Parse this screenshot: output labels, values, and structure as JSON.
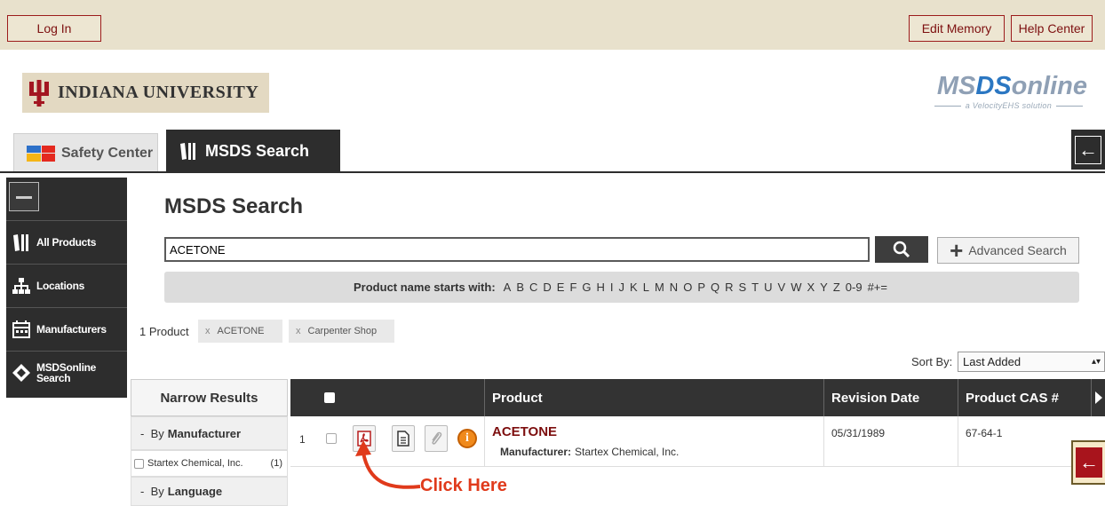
{
  "topbar": {
    "login": "Log In",
    "edit_memory": "Edit Memory",
    "help_center": "Help Center"
  },
  "header": {
    "university": "INDIANA UNIVERSITY",
    "brand": {
      "ms": "MS",
      "ds": "DS",
      "online": "online",
      "tagline": "a VelocityEHS solution"
    }
  },
  "tabs": [
    {
      "label": "Safety Center"
    },
    {
      "label": "MSDS Search"
    }
  ],
  "sidebar": {
    "items": [
      {
        "label": "All Products"
      },
      {
        "label": "Locations"
      },
      {
        "label": "Manufacturers"
      },
      {
        "label": "MSDSonline Search"
      }
    ]
  },
  "main": {
    "title": "MSDS Search",
    "search_value": "ACETONE",
    "advanced_search": "Advanced Search",
    "starts_with_label": "Product name starts with:",
    "letters": [
      "A",
      "B",
      "C",
      "D",
      "E",
      "F",
      "G",
      "H",
      "I",
      "J",
      "K",
      "L",
      "M",
      "N",
      "O",
      "P",
      "Q",
      "R",
      "S",
      "T",
      "U",
      "V",
      "W",
      "X",
      "Y",
      "Z",
      "0-9",
      "#+="
    ],
    "product_count": "1 Product",
    "chips": [
      {
        "x": "x",
        "label": "ACETONE"
      },
      {
        "x": "x",
        "label": "Carpenter Shop"
      }
    ],
    "sort_label": "Sort By:",
    "sort_value": "Last Added"
  },
  "narrow": {
    "title": "Narrow Results",
    "groups": [
      {
        "dash": "-",
        "prefix": "By",
        "name": "Manufacturer"
      },
      {
        "dash": "-",
        "prefix": "By",
        "name": "Language"
      }
    ],
    "manufacturer_option": {
      "label": "Startex Chemical, Inc.",
      "count": "(1)"
    }
  },
  "table": {
    "headers": {
      "product": "Product",
      "revision_date": "Revision Date",
      "cas": "Product CAS #"
    },
    "rows": [
      {
        "num": "1",
        "product": "ACETONE",
        "manufacturer_label": "Manufacturer:",
        "manufacturer": "Startex Chemical, Inc.",
        "revision_date": "05/31/1989",
        "cas": "67-64-1"
      }
    ]
  },
  "annotation": {
    "text": "Click Here",
    "color": "#e03a1b"
  },
  "colors": {
    "accent": "#7d0f0f",
    "dark": "#2d2d2d",
    "topbar": "#e8e1cc"
  }
}
